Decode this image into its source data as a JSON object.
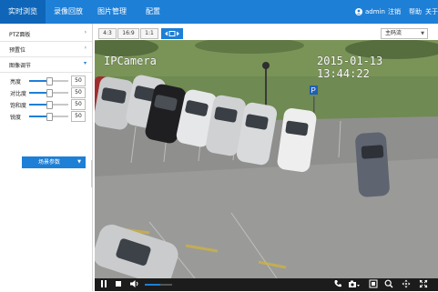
{
  "nav": {
    "tabs": [
      "实时浏览",
      "录像回放",
      "图片管理",
      "配置"
    ],
    "active": 0,
    "user": "admin",
    "logout": "注销",
    "help": "帮助",
    "about": "关于"
  },
  "sidebar": {
    "sections": [
      {
        "label": "PTZ面板",
        "state": "collapsed"
      },
      {
        "label": "预置位",
        "state": "collapsed"
      },
      {
        "label": "图像调节",
        "state": "expanded"
      }
    ],
    "sliders": [
      {
        "label": "亮度",
        "value": "50",
        "level": 0.5
      },
      {
        "label": "对比度",
        "value": "50",
        "level": 0.5
      },
      {
        "label": "饱和度",
        "value": "50",
        "level": 0.5
      },
      {
        "label": "锐度",
        "value": "50",
        "level": 0.5
      }
    ],
    "scene_button": "场景参数"
  },
  "toolbar": {
    "ratios": [
      "4:3",
      "16:9",
      "1:1"
    ],
    "stream": "主码流"
  },
  "video": {
    "osd_name": "IPCamera",
    "osd_datetime": "2015-01-13 13:44:22",
    "parking_sign": "P"
  },
  "controls": {
    "volume_level": 0.55
  },
  "colors": {
    "nav_bg": "#1e7fd6",
    "accent": "#1e7fd6",
    "control_bar": "#1c1c1c"
  }
}
